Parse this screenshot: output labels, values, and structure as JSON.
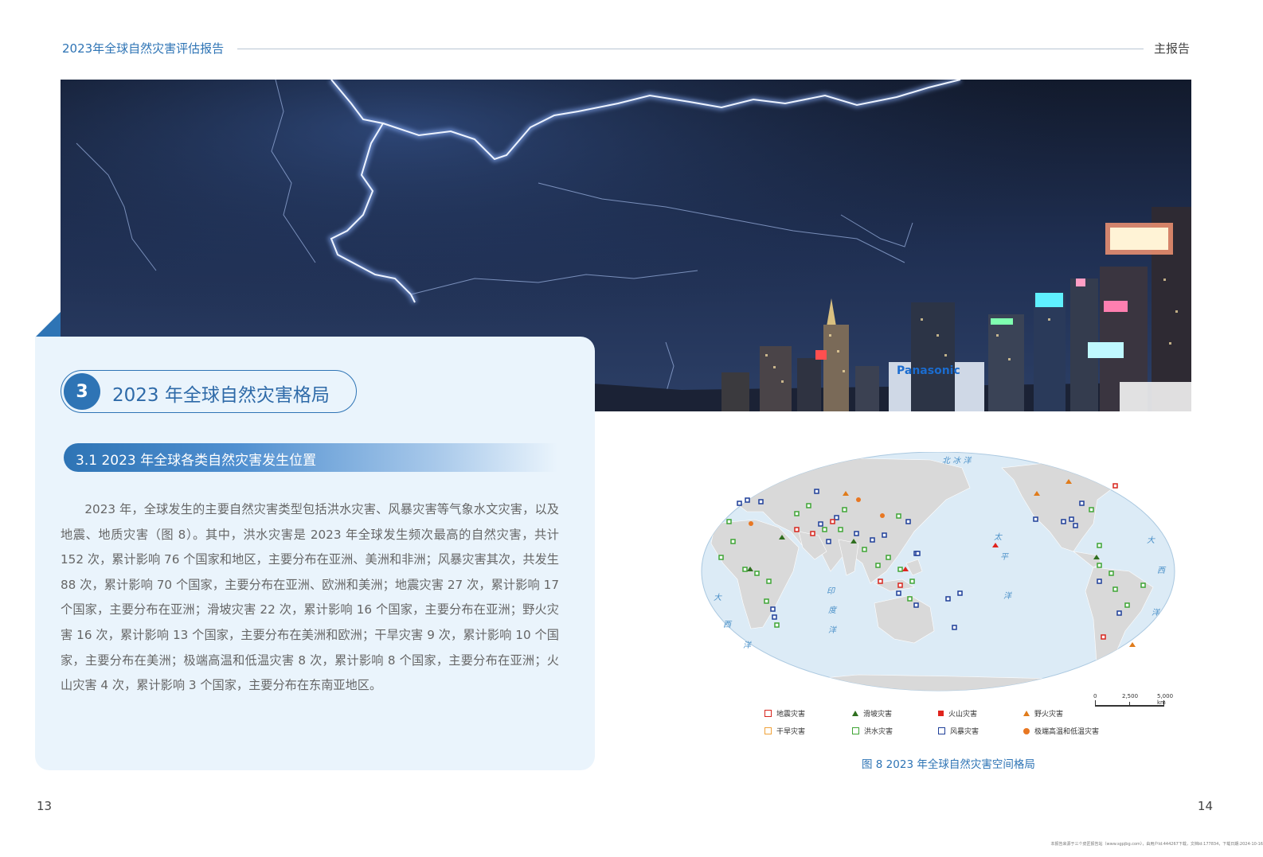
{
  "header": {
    "report_title": "2023年全球自然灾害评估报告",
    "section_label": "主报告"
  },
  "photo": {
    "sign_text": "Panasonic",
    "icon": "lightning-city-photo"
  },
  "section": {
    "number": "3",
    "title": "2023 年全球自然灾害格局"
  },
  "subsection": {
    "title": "3.1  2023 年全球各类自然灾害发生位置"
  },
  "body_text": "2023 年，全球发生的主要自然灾害类型包括洪水灾害、风暴灾害等气象水文灾害，以及地震、地质灾害（图 8）。其中，洪水灾害是 2023 年全球发生频次最高的自然灾害，共计 152 次，累计影响 76 个国家和地区，主要分布在亚洲、美洲和非洲；风暴灾害其次，共发生 88 次，累计影响 70 个国家，主要分布在亚洲、欧洲和美洲；地震灾害 27 次，累计影响 17 个国家，主要分布在亚洲；滑坡灾害 22 次，累计影响 16 个国家，主要分布在亚洲；野火灾害 16 次，累计影响 13 个国家，主要分布在美洲和欧洲；干旱灾害 9 次，累计影响 10 个国家，主要分布在美洲；极端高温和低温灾害 8 次，累计影响 8 个国家，主要分布在亚洲；火山灾害 4 次，累计影响 3 个国家，主要分布在东南亚地区。",
  "map": {
    "ocean_labels": {
      "arctic": "北 冰 洋",
      "pacific": [
        "太",
        "平",
        "洋"
      ],
      "indian": [
        "印",
        "度",
        "洋"
      ],
      "atlantic_west": [
        "大",
        "西",
        "洋"
      ],
      "atlantic_east": [
        "大",
        "西",
        "洋"
      ]
    },
    "scale": {
      "zero": "0",
      "mid": "2,500",
      "max": "5,000 km"
    },
    "colors": {
      "ocean": "#dcebf6",
      "land": "#d9d9d9",
      "flood": "#3fa535",
      "storm": "#1f3f99",
      "earthquake": "#d7261e",
      "landslide": "#2f6f1f",
      "volcano": "#e0241d",
      "wildfire": "#e07b1a",
      "drought": "#f0a23a",
      "temperature": "#e87722"
    }
  },
  "legend": [
    {
      "icon": "earthquake-icon",
      "label": "地震灾害"
    },
    {
      "icon": "landslide-icon",
      "label": "滑坡灾害"
    },
    {
      "icon": "volcano-icon",
      "label": "火山灾害"
    },
    {
      "icon": "wildfire-icon",
      "label": "野火灾害"
    },
    {
      "icon": "drought-icon",
      "label": "干旱灾害"
    },
    {
      "icon": "flood-icon",
      "label": "洪水灾害"
    },
    {
      "icon": "storm-icon",
      "label": "风暴灾害"
    },
    {
      "icon": "temperature-icon",
      "label": "极端高温和低温灾害"
    }
  ],
  "figure_caption": "图 8  2023 年全球自然灾害空间格局",
  "page_numbers": {
    "left": "13",
    "right": "14"
  },
  "footnote": "本报告来源于三个皮匠报告站（www.sgpjbg.com），由用户Id:444267下载，文档Id:177834，下载日期:2024-10-16"
}
